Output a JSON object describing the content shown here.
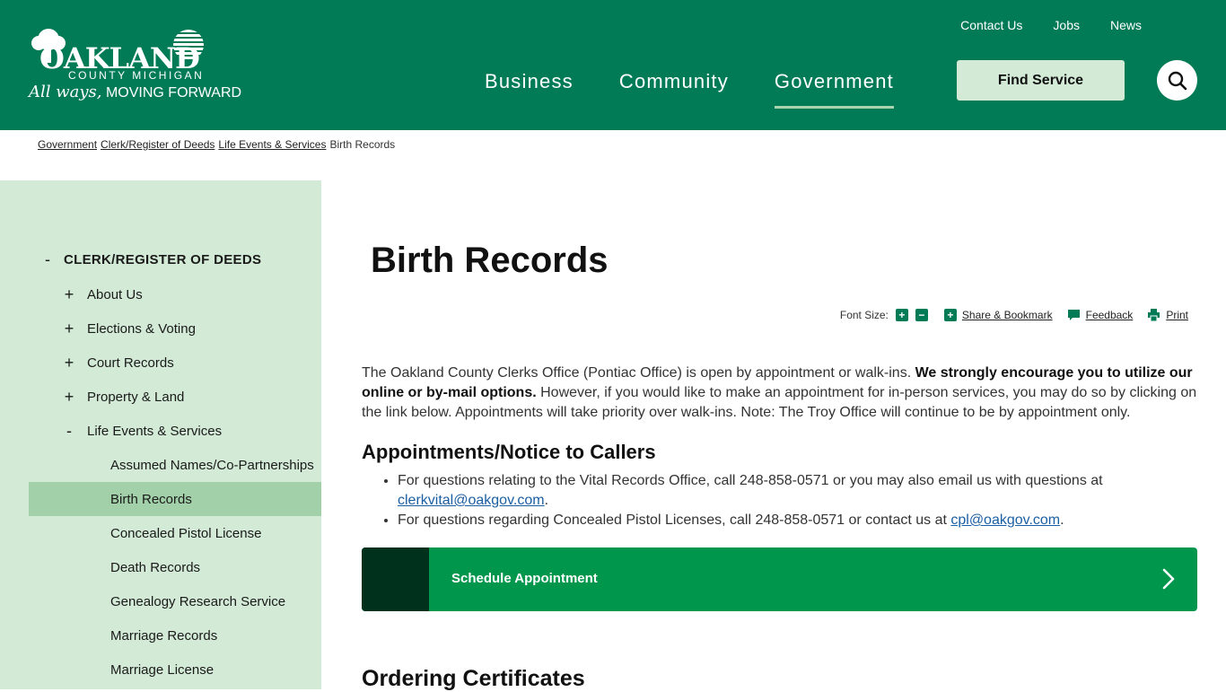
{
  "brand": {
    "logo_word": "OAKLAND",
    "logo_sub": "COUNTY MICHIGAN",
    "tagline_script": "All ways,",
    "tagline": "MOVING FORWARD",
    "primary_color": "#007b55",
    "accent_color": "#d2ead6"
  },
  "utility_nav": [
    "Contact Us",
    "Jobs",
    "News"
  ],
  "main_nav": [
    {
      "label": "Business",
      "active": false
    },
    {
      "label": "Community",
      "active": false
    },
    {
      "label": "Government",
      "active": true
    }
  ],
  "find_service_label": "Find Service",
  "search_icon": "search-icon",
  "breadcrumb": {
    "links": [
      "Government",
      "Clerk/Register of Deeds",
      "Life Events & Services"
    ],
    "current": "Birth Records"
  },
  "sidebar": {
    "heading": {
      "toggle": "-",
      "label": "CLERK/REGISTER OF DEEDS"
    },
    "items": [
      {
        "toggle": "+",
        "label": "About Us"
      },
      {
        "toggle": "+",
        "label": "Elections & Voting"
      },
      {
        "toggle": "+",
        "label": "Court Records"
      },
      {
        "toggle": "+",
        "label": "Property & Land"
      },
      {
        "toggle": "-",
        "label": "Life Events & Services"
      }
    ],
    "subitems": [
      {
        "label": "Assumed Names/Co-Partnerships",
        "current": false
      },
      {
        "label": "Birth Records",
        "current": true
      },
      {
        "label": "Concealed Pistol License",
        "current": false
      },
      {
        "label": "Death Records",
        "current": false
      },
      {
        "label": "Genealogy Research Service",
        "current": false
      },
      {
        "label": "Marriage Records",
        "current": false
      },
      {
        "label": "Marriage License",
        "current": false
      }
    ]
  },
  "page": {
    "title": "Birth Records",
    "tools": {
      "font_size_label": "Font Size:",
      "increase": "+",
      "decrease": "−",
      "share": "Share & Bookmark",
      "feedback": "Feedback",
      "print": "Print"
    },
    "intro_part1": "The Oakland County Clerks Office (Pontiac Office) is open by appointment or walk-ins. ",
    "intro_bold": "We strongly encourage you to utilize our online or by-mail options.",
    "intro_part2": " However, if you would like to make an appointment for in-person services, you may do so by clicking on the link below. Appointments will take priority over walk-ins. Note: The Troy Office will continue to be by appointment only.",
    "section1_heading": "Appointments/Notice to Callers",
    "bullet1_text": "For questions relating to the Vital Records Office, call 248-858-0571 or you may also email us with questions at ",
    "bullet1_link": "clerkvital@oakgov.com",
    "bullet1_end": ".",
    "bullet2_text": "For questions regarding Concealed Pistol Licenses, call 248-858-0571 or contact us at ",
    "bullet2_link": "cpl@oakgov.com",
    "bullet2_end": ".",
    "appointment_button": "Schedule Appointment",
    "section2_heading": "Ordering Certificates"
  }
}
